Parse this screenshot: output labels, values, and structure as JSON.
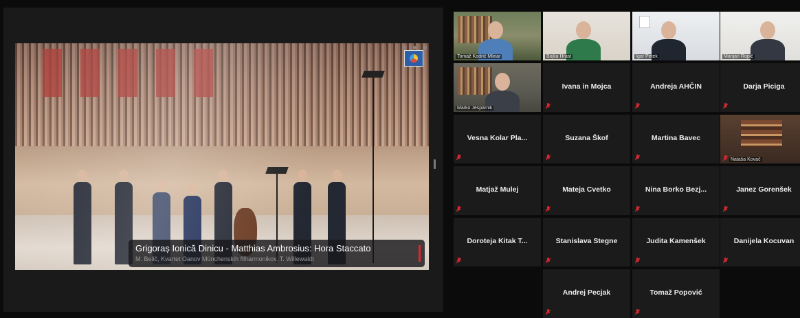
{
  "shared_screen": {
    "caption_title": "Grigoraș Ionică Dinicu - Matthias Ambrosius: Hora Staccato",
    "caption_subtitle": "M. Belič, Kvartet Oanov Münchenskih filharmonikov, T. Willewaldt"
  },
  "participants": [
    {
      "name": "Tomaž Kodrič Mlinar",
      "video": true,
      "active_speaker": true
    },
    {
      "name": "Bojka Hrast",
      "video": true
    },
    {
      "name": "Igor Petek",
      "video": true
    },
    {
      "name": "Marijan Ropič",
      "video": true
    },
    {
      "name": "Marko Jesparnik",
      "video": true
    },
    {
      "name": "Ivana in Mojca",
      "video": false,
      "muted": true
    },
    {
      "name": "Andreja AHČIN",
      "video": false,
      "muted": true
    },
    {
      "name": "Darja Piciga",
      "video": false,
      "muted": true
    },
    {
      "name": "Vesna Kolar Pla...",
      "video": false,
      "muted": true
    },
    {
      "name": "Suzana Škof",
      "video": false,
      "muted": true
    },
    {
      "name": "Martina Bavec",
      "video": false,
      "muted": true
    },
    {
      "name": "Nataša Kovač",
      "video": true,
      "muted": true
    },
    {
      "name": "Matjaž Mulej",
      "video": false,
      "muted": true
    },
    {
      "name": "Mateja Cvetko",
      "video": false,
      "muted": true
    },
    {
      "name": "Nina Borko Bezj...",
      "video": false,
      "muted": true
    },
    {
      "name": "Janez Gorenšek",
      "video": false,
      "muted": true
    },
    {
      "name": "Doroteja Kitak T...",
      "video": false,
      "muted": true
    },
    {
      "name": "Stanislava Stegne",
      "video": false,
      "muted": true
    },
    {
      "name": "Judita Kamenšek",
      "video": false,
      "muted": true
    },
    {
      "name": "Danijela Kocuvan",
      "video": false,
      "muted": true
    },
    {
      "name": "Andrej Pecjak",
      "video": false,
      "muted": true
    },
    {
      "name": "Tomaž Popović",
      "video": false,
      "muted": true
    }
  ],
  "colors": {
    "background": "#0b0b0b",
    "tile_background": "#1b1b1b",
    "active_speaker_border": "#b7d84a",
    "mute_icon": "#e0262f"
  }
}
